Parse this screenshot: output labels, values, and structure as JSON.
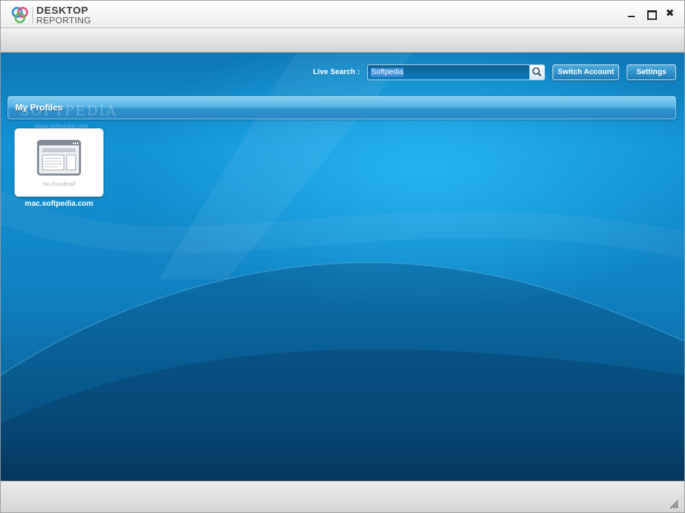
{
  "app": {
    "logo_line1": "DESKTOP",
    "logo_line2": "REPORTING"
  },
  "colors": {
    "accent": "#1293d6",
    "logo_blue": "#3a8fd4",
    "logo_red": "#e0477a",
    "logo_green": "#5cb85c"
  },
  "window_controls": {
    "close_glyph": "✖"
  },
  "search": {
    "label": "Live Search :",
    "value": "Softpedia"
  },
  "toolbar": {
    "switch_account_label": "Switch Account",
    "settings_label": "Settings"
  },
  "profiles": {
    "title": "My Profiles",
    "watermark": "SOFTPEDIA",
    "watermark_url": "www.softpedia.com",
    "items": [
      {
        "label": "mac.softpedia.com",
        "thumbnail_text": "No thumbnail",
        "icon": "browser-window-icon"
      }
    ]
  }
}
